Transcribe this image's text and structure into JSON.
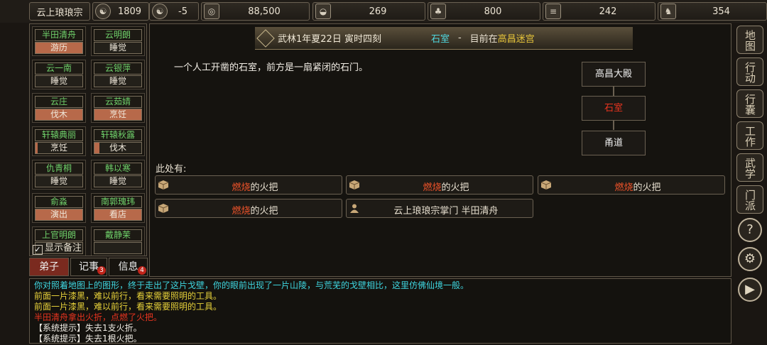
{
  "topbar": {
    "sect_name": "云上琅琅宗",
    "resources": [
      {
        "icon": "medal-icon",
        "glyph": "☯",
        "value": "1809"
      },
      {
        "icon": "yin-yang-icon",
        "glyph": "☯",
        "value": "-5"
      },
      {
        "icon": "coin-icon",
        "glyph": "◎",
        "value": "88,500"
      },
      {
        "icon": "food-bowl-icon",
        "glyph": "◒",
        "value": "269"
      },
      {
        "icon": "herb-icon",
        "glyph": "♣",
        "value": "800"
      },
      {
        "icon": "wood-icon",
        "glyph": "≡",
        "value": "242"
      },
      {
        "icon": "beast-icon",
        "glyph": "♞",
        "value": "354"
      }
    ]
  },
  "disciples": [
    {
      "name": "半田清舟",
      "action": "游历",
      "progress": 1.0
    },
    {
      "name": "云明朗",
      "action": "睡觉",
      "progress": 0.0
    },
    {
      "name": "云一南",
      "action": "睡觉",
      "progress": 0.0
    },
    {
      "name": "云银萍",
      "action": "睡觉",
      "progress": 0.0
    },
    {
      "name": "云庄",
      "action": "伐木",
      "progress": 1.0
    },
    {
      "name": "云茹婧",
      "action": "烹饪",
      "progress": 1.0
    },
    {
      "name": "轩辕典丽",
      "action": "烹饪",
      "progress": 0.05
    },
    {
      "name": "轩辕秋露",
      "action": "伐木",
      "progress": 0.1
    },
    {
      "name": "仇青桐",
      "action": "睡觉",
      "progress": 0.0
    },
    {
      "name": "韩以寒",
      "action": "睡觉",
      "progress": 0.0
    },
    {
      "name": "俞淼",
      "action": "演出",
      "progress": 1.0
    },
    {
      "name": "南郭瑰玮",
      "action": "看店",
      "progress": 1.0
    },
    {
      "name": "上官明朗",
      "action": "",
      "progress": 0.0
    },
    {
      "name": "戴静茉",
      "action": "",
      "progress": 0.0
    }
  ],
  "show_notes": "显示备注",
  "left_tabs": [
    {
      "label": "弟子",
      "badge": ""
    },
    {
      "label": "记事",
      "badge": "3"
    },
    {
      "label": "信息",
      "badge": "4"
    }
  ],
  "location": {
    "date": "武林1年夏22日 寅时四刻",
    "room": "石室",
    "separator": "-",
    "prefix": "目前在",
    "place": "高昌迷宫"
  },
  "room_desc": "一个人工开凿的石室，前方是一扇紧闭的石门。",
  "map": {
    "north": "高昌大殿",
    "current": "石室",
    "south": "甬道"
  },
  "here_label": "此处有:",
  "objects": [
    {
      "icon": "box-icon",
      "highlight": "燃烧",
      "text": "的火把"
    },
    {
      "icon": "box-icon",
      "highlight": "燃烧",
      "text": "的火把"
    },
    {
      "icon": "box-icon",
      "highlight": "燃烧",
      "text": "的火把"
    },
    {
      "icon": "box-icon",
      "highlight": "燃烧",
      "text": "的火把"
    },
    {
      "icon": "person-icon",
      "highlight": "",
      "text": "云上琅琅宗掌门 半田清舟"
    }
  ],
  "log": [
    {
      "text": "你对照着地图上的图形，终于走出了这片戈壁，你的眼前出现了一片山陵，与荒芜的戈壁相比，这里仿佛仙境一般。",
      "color": "#3fd6e0"
    },
    {
      "text": "前面一片漆黑，难以前行，看来需要照明的工具。",
      "color": "#e8d23a"
    },
    {
      "text": "前面一片漆黑，难以前行，看来需要照明的工具。",
      "color": "#e8d23a"
    },
    {
      "text": "半田清舟拿出火折，点燃了火把。",
      "color": "#e8341f"
    },
    {
      "text": "【系统提示】失去1支火折。",
      "color": "#f0ece4"
    },
    {
      "text": "【系统提示】失去1根火把。",
      "color": "#f0ece4"
    }
  ],
  "right_menu": [
    {
      "label": "地图",
      "icon": "map-menu"
    },
    {
      "label": "行动",
      "icon": "action-menu"
    },
    {
      "label": "行囊",
      "icon": "bag-menu"
    },
    {
      "label": "工作",
      "icon": "work-menu"
    },
    {
      "label": "武学",
      "icon": "martial-menu"
    },
    {
      "label": "门派",
      "icon": "sect-menu"
    }
  ],
  "right_round": [
    {
      "glyph": "?",
      "icon": "help-icon"
    },
    {
      "glyph": "⚙",
      "icon": "settings-gear-icon"
    },
    {
      "glyph": "▶",
      "icon": "play-icon"
    }
  ]
}
